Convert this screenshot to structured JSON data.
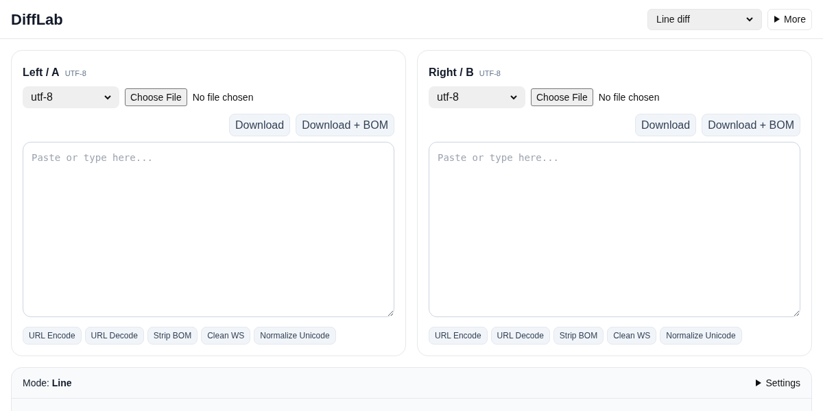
{
  "header": {
    "title": "DiffLab",
    "mode_select": {
      "value": "Line diff"
    },
    "more_button": {
      "label": "More",
      "expanded": false
    }
  },
  "panels": [
    {
      "title": "Left / A",
      "encoding_badge": "UTF-8",
      "encoding_select": {
        "value": "utf-8"
      },
      "file": {
        "button": "Choose File",
        "status": "No file chosen"
      },
      "actions": [
        "Download",
        "Download + BOM"
      ],
      "editor": {
        "placeholder": "Paste or type here..."
      },
      "tools": [
        "URL Encode",
        "URL Decode",
        "Strip BOM",
        "Clean WS",
        "Normalize Unicode"
      ]
    },
    {
      "title": "Right / B",
      "encoding_badge": "UTF-8",
      "encoding_select": {
        "value": "utf-8"
      },
      "file": {
        "button": "Choose File",
        "status": "No file chosen"
      },
      "actions": [
        "Download",
        "Download + BOM"
      ],
      "editor": {
        "placeholder": "Paste or type here..."
      },
      "tools": [
        "URL Encode",
        "URL Decode",
        "Strip BOM",
        "Clean WS",
        "Normalize Unicode"
      ]
    }
  ],
  "results": {
    "mode": "Mode: **Line**",
    "settings": {
      "label": "Settings",
      "expanded": false
    }
  }
}
